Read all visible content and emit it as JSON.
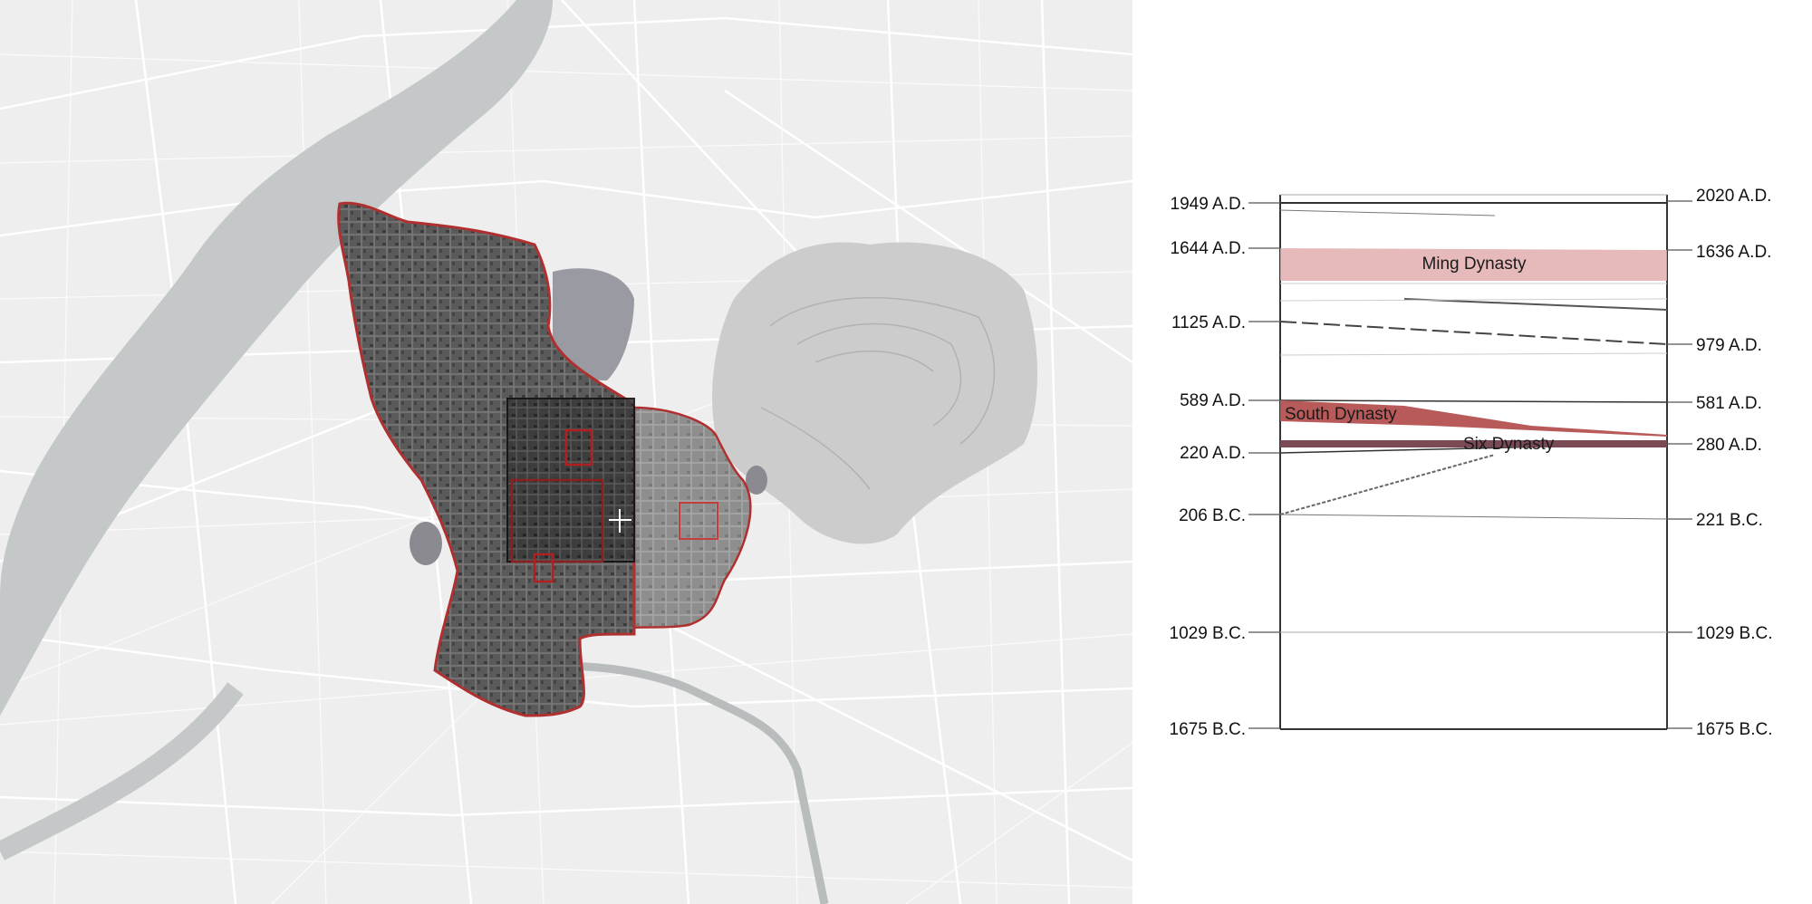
{
  "map": {
    "background": "#eeeeee",
    "river_color": "#c4c8c8",
    "city_outline_color": "#b03030",
    "lake_color": "#9a9aa2",
    "mountain_color": "#c8c8c8",
    "crosshair": "white-crosshair-icon"
  },
  "timeline": {
    "left_labels": [
      "1949 A.D.",
      "1644 A.D.",
      "1125 A.D.",
      "589 A.D.",
      "220 A.D.",
      "206 B.C.",
      "1029 B.C.",
      "1675 B.C."
    ],
    "right_labels": [
      "2020 A.D.",
      "1636 A.D.",
      "979 A.D.",
      "581 A.D.",
      "280 A.D.",
      "221 B.C.",
      "1029 B.C.",
      "1675 B.C."
    ],
    "bands": {
      "ming": "Ming Dynasty",
      "south": "South Dynasty",
      "six": "Six Dynasty"
    },
    "colors": {
      "ming": "#e2aeae",
      "south": "#b85a5a",
      "six": "#7a4a55",
      "frame": "#333333"
    }
  }
}
